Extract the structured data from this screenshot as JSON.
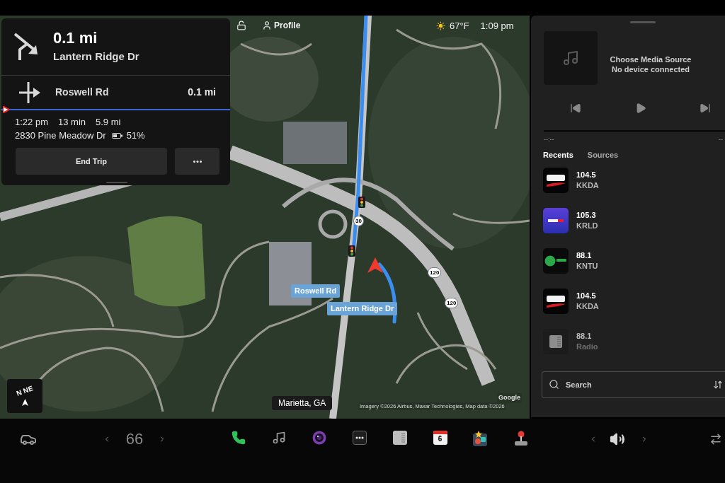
{
  "status_bar": {
    "profile": "Profile",
    "temperature": "67°F",
    "time": "1:09 pm"
  },
  "navigation": {
    "next_maneuver": {
      "distance": "0.1 mi",
      "street": "Lantern Ridge Dr"
    },
    "then_maneuver": {
      "street": "Roswell Rd",
      "distance": "0.1 mi"
    },
    "trip": {
      "arrival": "1:22 pm",
      "duration": "13 min",
      "distance": "5.9 mi",
      "destination": "2830 Pine Meadow Dr",
      "battery": "51%"
    },
    "end_button": "End Trip"
  },
  "map": {
    "street_labels": [
      "Roswell Rd",
      "Lantern Ridge Dr"
    ],
    "route_shields": [
      "30",
      "120",
      "120"
    ],
    "compass": [
      "N",
      "NE"
    ],
    "location": "Marietta, GA",
    "attribution": "Imagery ©2026 Airbus, Maxar Technologies, Map data ©2026",
    "provider": "Google"
  },
  "media": {
    "title": "Choose Media Source",
    "subtitle": "No device connected",
    "elapsed": "--:--",
    "remaining": "--",
    "tabs": [
      {
        "label": "Recents",
        "selected": true
      },
      {
        "label": "Sources",
        "selected": false
      }
    ],
    "stations": [
      {
        "frequency": "104.5",
        "name": "KKDA",
        "kind": "swoosh"
      },
      {
        "frequency": "105.3",
        "name": "KRLD",
        "kind": "banner"
      },
      {
        "frequency": "88.1",
        "name": "KNTU",
        "kind": "disc"
      },
      {
        "frequency": "104.5",
        "name": "KKDA",
        "kind": "swoosh"
      },
      {
        "frequency": "88.1",
        "name": "Radio",
        "kind": "generic"
      }
    ],
    "search": {
      "placeholder": "Search"
    }
  },
  "dock": {
    "temperature": "66",
    "calendar_day": "6"
  }
}
